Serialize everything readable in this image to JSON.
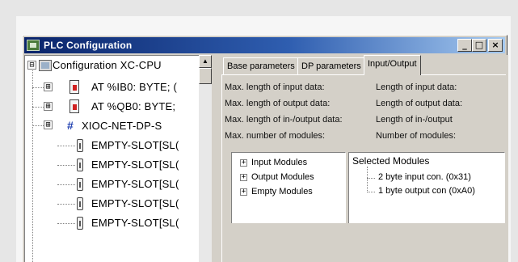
{
  "window": {
    "title": "PLC Configuration",
    "buttons": {
      "minimize": "_",
      "maximize": "□",
      "close": "×"
    }
  },
  "tree": {
    "root": {
      "label": "Configuration XC-CPU",
      "expander": "⊟"
    },
    "nodes": [
      {
        "label": "AT %IB0: BYTE; (",
        "expander": "⊞",
        "icon": "input-module-icon"
      },
      {
        "label": "AT %QB0: BYTE;",
        "expander": "⊞",
        "icon": "output-module-icon"
      },
      {
        "label": "XIOC-NET-DP-S",
        "expander": "⊞",
        "icon": "network-module-icon"
      },
      {
        "label": "EMPTY-SLOT[SL(",
        "icon": "slot-icon"
      },
      {
        "label": "EMPTY-SLOT[SL(",
        "icon": "slot-icon"
      },
      {
        "label": "EMPTY-SLOT[SL(",
        "icon": "slot-icon"
      },
      {
        "label": "EMPTY-SLOT[SL(",
        "icon": "slot-icon"
      },
      {
        "label": "EMPTY-SLOT[SL(",
        "icon": "slot-icon"
      }
    ]
  },
  "tabs": [
    {
      "label": "Base parameters"
    },
    {
      "label": "DP parameters"
    },
    {
      "label": "Input/Output"
    }
  ],
  "params": {
    "left": [
      "Max. length of input data:",
      "Max. length of output data:",
      "Max. length of in-/output data:",
      "Max. number of modules:"
    ],
    "right": [
      "Length of input data:",
      "Length of output data:",
      "Length of in-/output",
      "Number of modules:"
    ]
  },
  "modules": {
    "available": [
      {
        "label": "Input Modules",
        "expander": "+"
      },
      {
        "label": "Output Modules",
        "expander": "+"
      },
      {
        "label": "Empty Modules",
        "expander": "+"
      }
    ],
    "selected_header": "Selected Modules",
    "selected": [
      "2 byte input con. (0x31)",
      "1 byte output con (0xA0)"
    ]
  }
}
